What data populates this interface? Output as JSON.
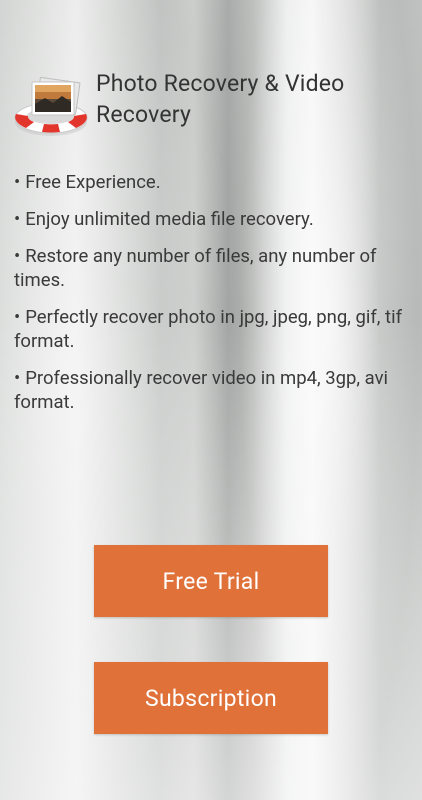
{
  "app": {
    "title": "Photo Recovery & Video Recovery",
    "icon": "lifebuoy-photo-icon"
  },
  "features": [
    {
      "text": "Free Experience."
    },
    {
      "text": "Enjoy unlimited media file recovery."
    },
    {
      "text": "Restore any number of files, any number of times."
    },
    {
      "text": "Perfectly recover photo in jpg, jpeg, png, gif, tif format."
    },
    {
      "text": "Professionally recover video in mp4, 3gp, avi format."
    }
  ],
  "buttons": {
    "free_trial": "Free Trial",
    "subscription": "Subscription"
  },
  "colors": {
    "accent": "#e07139",
    "text": "#333333"
  }
}
